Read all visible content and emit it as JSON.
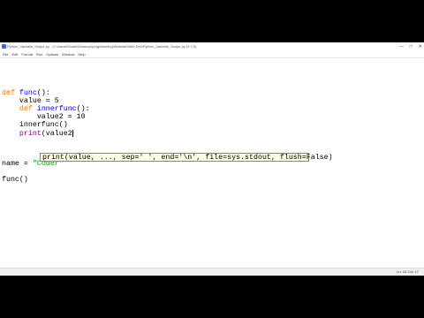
{
  "window": {
    "title": "Python_Variable_Scope.py - C:\\Users\\Owais\\Desktop\\programming\\Website\\Web Dev\\Python_Variable_Scope.py (3.7.0)",
    "controls": [
      "—",
      "□",
      "✕"
    ]
  },
  "menu": [
    "File",
    "Edit",
    "Format",
    "Run",
    "Options",
    "Window",
    "Help"
  ],
  "code": {
    "l1_kw": "def",
    "l1_fn": "func",
    "l1_rest": "():",
    "l2": "    value = 5",
    "l3_indent": "    ",
    "l3_kw": "def",
    "l3_fn": "innerfunc",
    "l3_rest": "():",
    "l4": "        value2 = 10",
    "l5": "    innerfunc()",
    "l6_indent": "    ",
    "l6_bi": "print",
    "l6_rest": "(value2",
    "l7_pre": "name = ",
    "l7_str": "\"Coder\"",
    "l8": "func()"
  },
  "calltip": {
    "text": "print(value, ..., sep=' ', end='\\n', file=sys.stdout, flush=False)"
  },
  "status": {
    "text": "Ln: 10   Col: 17"
  }
}
